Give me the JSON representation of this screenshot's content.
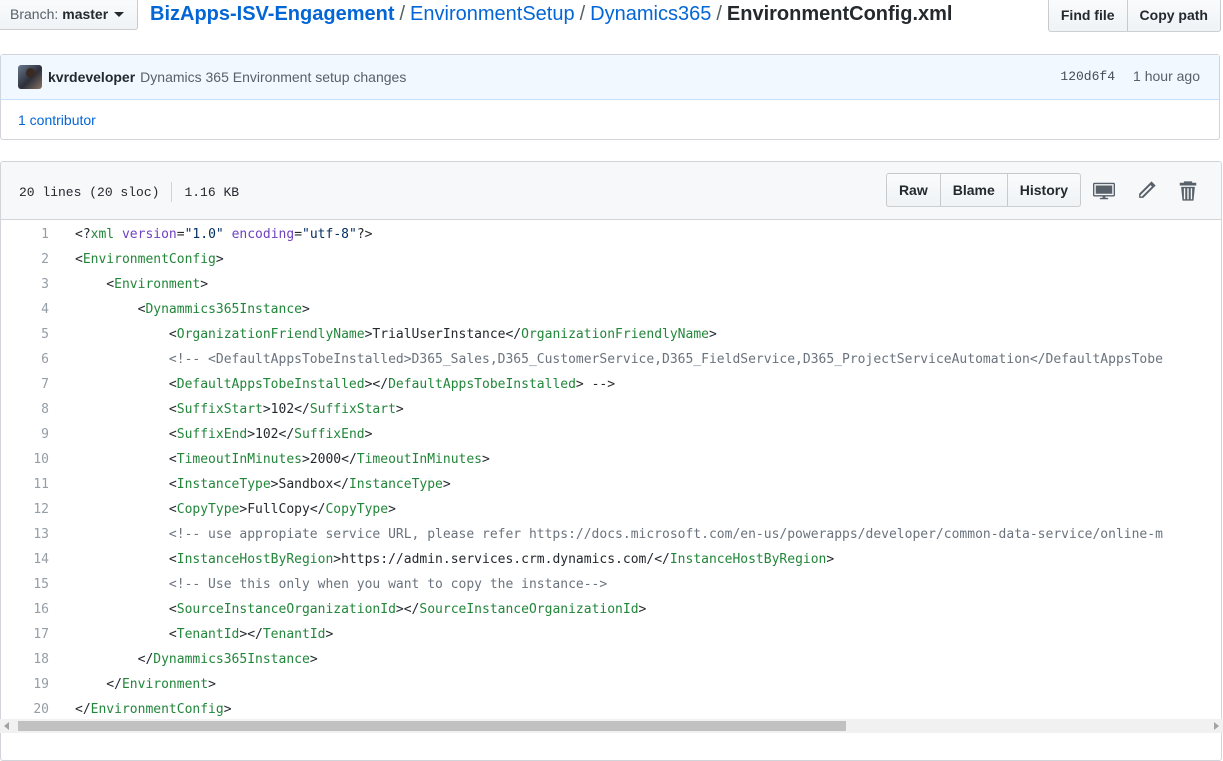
{
  "branch": {
    "prefix": "Branch:",
    "name": "master"
  },
  "breadcrumb": {
    "repo": "BizApps-ISV-Engagement",
    "folder1": "EnvironmentSetup",
    "folder2": "Dynamics365",
    "file": "EnvironmentConfig.xml",
    "separator": "/"
  },
  "file_nav": {
    "find_file": "Find file",
    "copy_path": "Copy path"
  },
  "commit": {
    "author": "kvrdeveloper",
    "message": "Dynamics 365 Environment setup changes",
    "sha": "120d6f4",
    "time": "1 hour ago",
    "contributors": "1 contributor"
  },
  "file_header": {
    "lines": "20 lines (20 sloc)",
    "size": "1.16 KB",
    "raw": "Raw",
    "blame": "Blame",
    "history": "History",
    "icons": [
      "desktop-icon",
      "pencil-icon",
      "trash-icon"
    ]
  },
  "colors": {
    "link": "#0366d6",
    "tag": "#22863a",
    "attr": "#6f42c1",
    "string": "#032f62",
    "comment": "#6a737d"
  },
  "code": {
    "lines": [
      {
        "num": "1",
        "text": "<?xml version=\"1.0\" encoding=\"utf-8\"?>"
      },
      {
        "num": "2",
        "text": "<EnvironmentConfig>"
      },
      {
        "num": "3",
        "text": "    <Environment>"
      },
      {
        "num": "4",
        "text": "        <Dynammics365Instance>"
      },
      {
        "num": "5",
        "text": "            <OrganizationFriendlyName>TrialUserInstance</OrganizationFriendlyName>"
      },
      {
        "num": "6",
        "text": "            <!-- <DefaultAppsTobeInstalled>D365_Sales,D365_CustomerService,D365_FieldService,D365_ProjectServiceAutomation</DefaultAppsTobe"
      },
      {
        "num": "7",
        "text": "            <DefaultAppsTobeInstalled></DefaultAppsTobeInstalled> -->"
      },
      {
        "num": "8",
        "text": "            <SuffixStart>102</SuffixStart>"
      },
      {
        "num": "9",
        "text": "            <SuffixEnd>102</SuffixEnd>"
      },
      {
        "num": "10",
        "text": "            <TimeoutInMinutes>2000</TimeoutInMinutes>"
      },
      {
        "num": "11",
        "text": "            <InstanceType>Sandbox</InstanceType>"
      },
      {
        "num": "12",
        "text": "            <CopyType>FullCopy</CopyType>"
      },
      {
        "num": "13",
        "text": "            <!-- use appropiate service URL, please refer https://docs.microsoft.com/en-us/powerapps/developer/common-data-service/online-m"
      },
      {
        "num": "14",
        "text": "            <InstanceHostByRegion>https://admin.services.crm.dynamics.com/</InstanceHostByRegion>"
      },
      {
        "num": "15",
        "text": "            <!-- Use this only when you want to copy the instance-->"
      },
      {
        "num": "16",
        "text": "            <SourceInstanceOrganizationId></SourceInstanceOrganizationId>"
      },
      {
        "num": "17",
        "text": "            <TenantId></TenantId>"
      },
      {
        "num": "18",
        "text": "        </Dynammics365Instance>"
      },
      {
        "num": "19",
        "text": "    </Environment>"
      },
      {
        "num": "20",
        "text": "</EnvironmentConfig>"
      }
    ]
  }
}
